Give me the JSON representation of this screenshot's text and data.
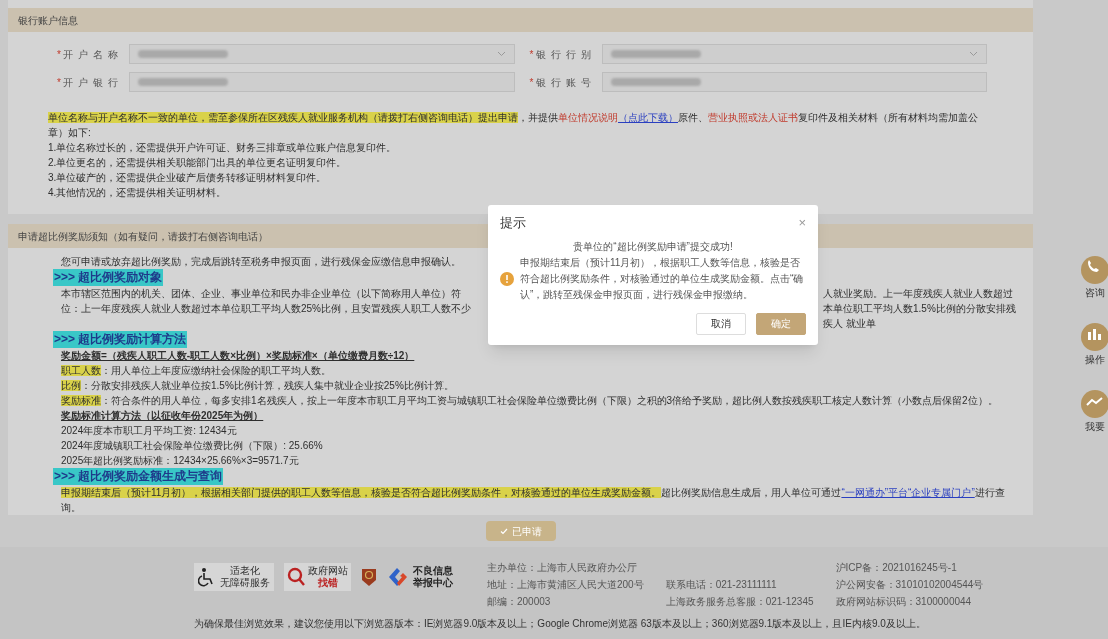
{
  "bank_section": {
    "title": "银行账户信息",
    "fields": [
      {
        "marker": "*",
        "label": "开户名称",
        "kind": "select"
      },
      {
        "marker": "*",
        "label": "银行行别",
        "kind": "select"
      },
      {
        "marker": "*",
        "label": "开户银行",
        "kind": "input"
      },
      {
        "marker": "*",
        "label": "银行账号",
        "kind": "input"
      }
    ],
    "notice": [
      {
        "text": "单位名称与开户名称不一致的单位，需至参保所在区残疾人就业服务机构（请拨打右侧咨询电话）提出申请",
        "kind": "highlight"
      },
      {
        "text": "，并提供",
        "kind": "plain"
      },
      {
        "text": "单位情况说明",
        "kind": "red"
      },
      {
        "text": "（点此下载）",
        "kind": "link"
      },
      {
        "text": "原件、",
        "kind": "plain"
      },
      {
        "text": "营业执照或法人证书",
        "kind": "red"
      },
      {
        "text": "复印件及相关材料（所有材料均需加盖公章）如下:",
        "kind": "plain"
      }
    ],
    "notes": [
      "1.单位名称过长的，还需提供开户许可证、财务三排章或单位账户信息复印件。",
      "2.单位更名的，还需提供相关职能部门出具的单位更名证明复印件。",
      "3.单位破产的，还需提供企业破产后债务转移证明材料复印件。",
      "4.其他情况的，还需提供相关证明材料。"
    ]
  },
  "guide_section": {
    "title": "申请超比例奖励须知（如有疑问，请拨打右侧咨询电话）",
    "lines": [
      {
        "kind": "text",
        "parts": [
          {
            "text": "您可申请或放弃超比例奖励，完成后跳转至税务申报页面，进行残保金应缴信息申报确认。",
            "kind": "plain"
          }
        ]
      },
      {
        "kind": "heading",
        "text": ">>> 超比例奖励对象"
      },
      {
        "kind": "split",
        "left": [
          "本市辖区范围内的机关、团体、企业、事业单位和民办非企业单位（以下简称用人单位）符",
          "位：上一年度残疾人就业人数超过本单位职工平均人数25%比例，且安置残疾人职工人数不少"
        ],
        "right": "人就业奖励。上一年度残疾人就业人数超过本单位职工平均人数1.5%比例的分散安排残疾人 就业单"
      },
      {
        "kind": "heading",
        "text": ">>> 超比例奖励计算方法"
      },
      {
        "kind": "formula",
        "parts": [
          {
            "text": "奖励金额=（残疾人职工人数-职工人数×比例）×奖励标准×（单位缴费月数÷12）",
            "kind": "plain"
          }
        ]
      },
      {
        "kind": "text",
        "parts": [
          {
            "text": "职工人数",
            "kind": "highlight"
          },
          {
            "text": "：用人单位上年度应缴纳社会保险的职工平均人数。",
            "kind": "plain"
          }
        ]
      },
      {
        "kind": "text",
        "parts": [
          {
            "text": "比例",
            "kind": "highlight"
          },
          {
            "text": "：分散安排残疾人就业单位按1.5%比例计算，残疾人集中就业企业按25%比例计算。",
            "kind": "plain"
          }
        ]
      },
      {
        "kind": "text",
        "parts": [
          {
            "text": "奖励标准",
            "kind": "highlight"
          },
          {
            "text": "：符合条件的用人单位，每多安排1名残疾人，按上一年度本市职工月平均工资与城镇职工社会保险单位缴费比例（下限）之积的3倍给予奖励，超比例人数按残疾职工核定人数计算（小数点后保留2位）。",
            "kind": "plain"
          }
        ]
      },
      {
        "kind": "formula",
        "parts": [
          {
            "text": "奖励标准计算方法（以征收年份2025年为例）",
            "kind": "plain"
          }
        ]
      },
      {
        "kind": "text",
        "parts": [
          {
            "text": "2024年度本市职工月平均工资: 12434元",
            "kind": "plain"
          }
        ]
      },
      {
        "kind": "text",
        "parts": [
          {
            "text": "2024年度城镇职工社会保险单位缴费比例（下限）: 25.66%",
            "kind": "plain"
          }
        ]
      },
      {
        "kind": "text",
        "parts": [
          {
            "text": "2025年超比例奖励标准：12434×25.66%×3=9571.7元",
            "kind": "plain"
          }
        ]
      },
      {
        "kind": "heading",
        "text": ">>> 超比例奖励金额生成与查询"
      },
      {
        "kind": "text",
        "parts": [
          {
            "text": "申报期结束后（预计11月初），根据相关部门提供的职工人数等信息，核验是否符合超比例奖励条件，对核验通过的单位生成奖励金额。",
            "kind": "highlight"
          },
          {
            "text": "超比例奖励信息生成后，用人单位可通过",
            "kind": "plain"
          },
          {
            "text": "“一网通办”平台“企业专属门户”",
            "kind": "link"
          },
          {
            "text": "进行查询。",
            "kind": "plain"
          }
        ]
      }
    ],
    "submit_button": {
      "label": "已申请",
      "disabled": true
    }
  },
  "dialog": {
    "title": "提示",
    "close": "×",
    "headline": "贵单位的“超比例奖励申请”提交成功!",
    "message": "申报期结束后（预计11月初），根据职工人数等信息，核验是否符合超比例奖励条件，对核验通过的单位生成奖励金额。点击“确认”，跳转至残保金申报页面，进行残保金申报缴纳。",
    "buttons": [
      {
        "label": "取消",
        "kind": "secondary"
      },
      {
        "label": "确定",
        "kind": "primary"
      }
    ]
  },
  "side_tools": [
    "咨询",
    "操作",
    "我要"
  ],
  "footer": {
    "badges": [
      {
        "kind": "accessibility",
        "lines": [
          "适老化",
          "无障碍服务"
        ]
      },
      {
        "kind": "error_report",
        "lines": [
          "政府网站",
          "找错"
        ]
      },
      {
        "kind": "emblem"
      },
      {
        "kind": "report_center",
        "lines": [
          "不良信息",
          "举报中心"
        ]
      }
    ],
    "columns": [
      [
        "主办单位：上海市人民政府办公厅",
        "地址：上海市黄浦区人民大道200号",
        "邮编：200003"
      ],
      [
        "联系电话：021-23111111",
        "上海政务服务总客服：021-12345"
      ],
      [
        "沪ICP备：2021016245号-1",
        "沪公网安备：31010102004544号",
        "政府网站标识码：3100000044"
      ]
    ],
    "browser_note": "为确保最佳浏览效果，建议您使用以下浏览器版本：IE浏览器9.0版本及以上；Google Chrome浏览器 63版本及以上；360浏览器9.1版本及以上，且IE内核9.0及以上。"
  }
}
